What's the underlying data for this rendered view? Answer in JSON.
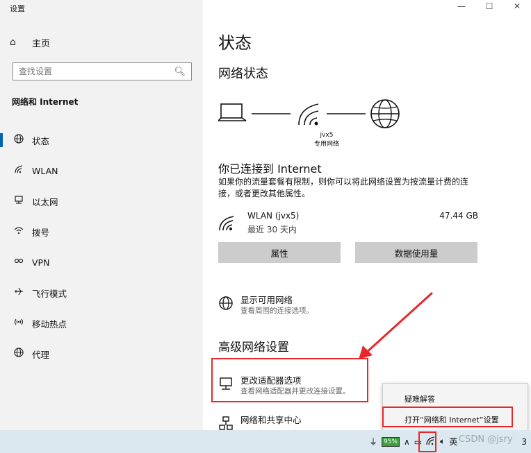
{
  "window": {
    "title": "设置",
    "controls": [
      "—",
      "☐",
      "✕"
    ]
  },
  "sidebar": {
    "home_label": "主页",
    "search_placeholder": "查找设置",
    "section_title": "网络和 Internet",
    "items": [
      {
        "label": "状态",
        "icon": "globe-icon",
        "active": true
      },
      {
        "label": "WLAN",
        "icon": "wifi-icon"
      },
      {
        "label": "以太网",
        "icon": "ethernet-icon"
      },
      {
        "label": "拨号",
        "icon": "dialup-icon"
      },
      {
        "label": "VPN",
        "icon": "vpn-icon"
      },
      {
        "label": "飞行模式",
        "icon": "airplane-icon"
      },
      {
        "label": "移动热点",
        "icon": "hotspot-icon"
      },
      {
        "label": "代理",
        "icon": "proxy-globe-icon"
      }
    ]
  },
  "main": {
    "title": "状态",
    "network_status_heading": "网络状态",
    "network_name": "jvx5",
    "network_type": "专用网络",
    "connected_title": "你已连接到 Internet",
    "connected_desc": "如果你的流量套餐有限制，则你可以将此网络设置为按流量计费的连接，或者更改其他属性。",
    "connection": {
      "name": "WLAN (jvx5)",
      "period": "最近 30 天内",
      "usage": "47.44 GB"
    },
    "buttons": {
      "properties": "属性",
      "data_usage": "数据使用量"
    },
    "show_networks": {
      "title": "显示可用网络",
      "subtitle": "查看周围的连接选项。"
    },
    "advanced_heading": "高级网络设置",
    "adapter_options": {
      "title": "更改适配器选项",
      "subtitle": "查看网络适配器并更改连接设置。"
    },
    "sharing_center": {
      "title": "网络和共享中心"
    }
  },
  "context_menu": {
    "items": [
      "疑难解答",
      "打开“网络和 Internet”设置"
    ]
  },
  "taskbar": {
    "battery": "95%",
    "ime": "英",
    "watermark": "CSDN @jsry",
    "badge": "3"
  },
  "colors": {
    "accent": "#0063b1",
    "highlight": "#e8272b",
    "button": "#cccccc",
    "taskbar": "#dbe8f0"
  }
}
